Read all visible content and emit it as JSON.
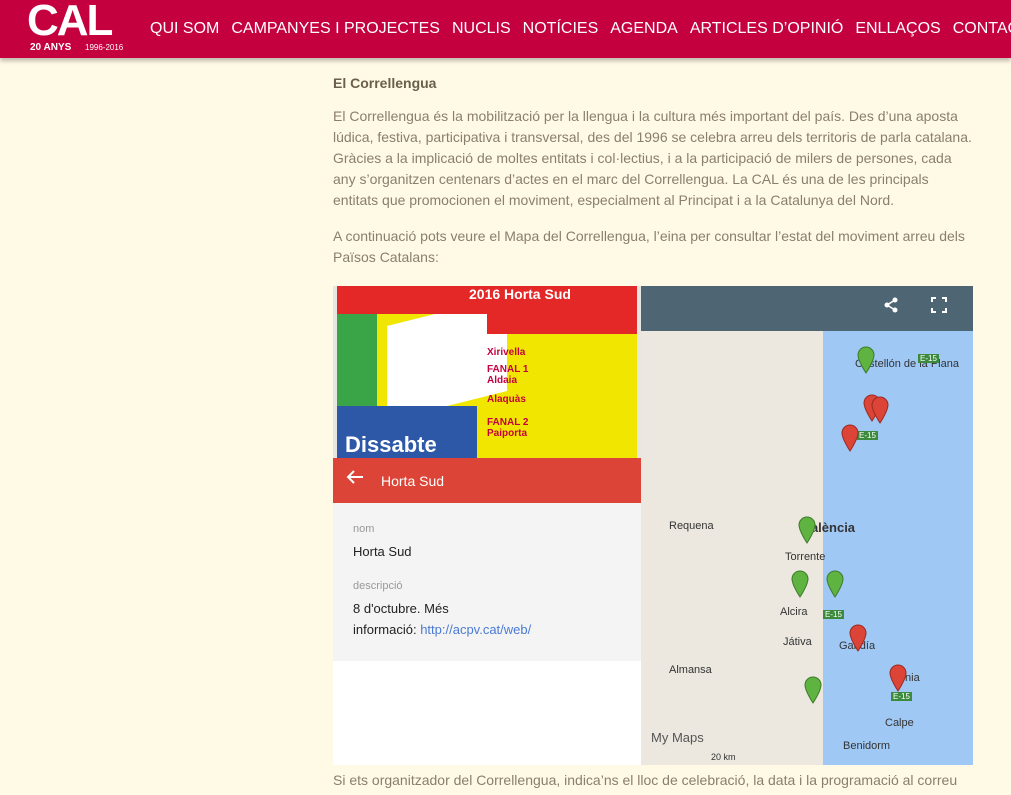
{
  "header": {
    "logo_main": "CAL",
    "logo_anys": "20 ANYS",
    "logo_years": "1996-2016",
    "nav": [
      "QUI SOM",
      "CAMPANYES I PROJECTES",
      "NUCLIS",
      "NOTÍCIES",
      "AGENDA",
      "ARTICLES D’OPINIÓ",
      "ENLLAÇOS",
      "CONTACTE"
    ]
  },
  "content": {
    "heading": "El Correllengua",
    "para1": "El Correllengua és la mobilització per la llengua i la cultura més important del país. Des d’una aposta lúdica, festiva, participativa i transversal, des del 1996 se celebra arreu dels territoris de parla catalana. Gràcies a la implicació de moltes entitats i col·lectius, i a la participació de milers de persones, cada any s’organitzen centenars d’actes en el marc del Correllengua. La CAL és una de les principals entitats que promocionen el moviment, especialment al Principat i a la Catalunya del Nord.",
    "para2": "A continuació pots veure el Mapa del Correllengua, l’eina per consultar l’estat del moviment arreu dels Països Catalans:",
    "bottom": "Si ets organitzador del Correllengua, indica’ns el lloc de celebració, la data i la programació al correu"
  },
  "poster": {
    "title": "2016 Horta Sud",
    "dissabte": "Dissabte",
    "lines": [
      "Xirivella",
      "FANAL 1",
      "Aldaia",
      "Alaquàs",
      "FANAL 2",
      "Paiporta"
    ]
  },
  "panel": {
    "title": "Horta Sud",
    "label_nom": "nom",
    "value_nom": "Horta Sud",
    "label_desc": "descripció",
    "desc_line1": "8 d'octubre. Més",
    "desc_prefix": "informació: ",
    "desc_link": "http://acpv.cat/web/"
  },
  "map": {
    "cities": [
      "Castellón de la Plana",
      "Requena",
      "València",
      "Torrente",
      "Alcira",
      "Játiva",
      "Gandía",
      "Almansa",
      "Dénia",
      "Calpe",
      "Benidorm"
    ],
    "roads": [
      "E-15",
      "E-15",
      "E-15",
      "E-15"
    ],
    "watermark": "My Maps",
    "scale": "20 km",
    "colors": {
      "green_pin": "#5fb340",
      "red_pin": "#db4437"
    }
  }
}
